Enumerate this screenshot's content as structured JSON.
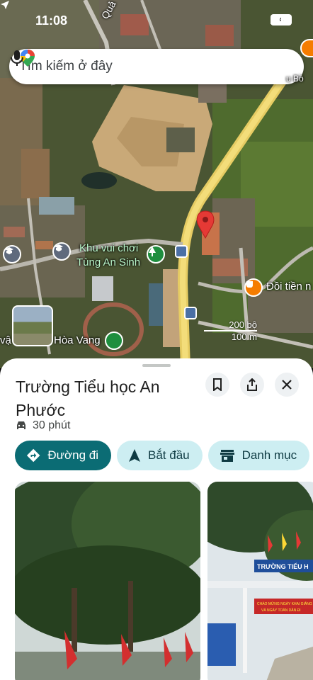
{
  "status_bar": {
    "time": "11:08",
    "battery": "4"
  },
  "search": {
    "placeholder": "Tìm kiếm ở đây"
  },
  "map": {
    "labels": {
      "park_line1": "Khu vui chơi",
      "park_line2": "Tùng An Sinh",
      "cafe": "Đồi tiền n",
      "hoa_vang": "Hòa Vang",
      "vat_prefix": "vậ",
      "road_top": "Quả",
      "top_right": "u Bồ"
    },
    "scale": {
      "feet": "200 bộ",
      "meters": "100 m"
    }
  },
  "place": {
    "title": "Trường Tiểu học An Phước",
    "travel_time": "30 phút",
    "buttons": {
      "directions": "Đường đi",
      "start": "Bắt đầu",
      "category": "Danh mục"
    },
    "photo2_sign": "TRƯỜNG TIỂU H",
    "photo2_banner1": "CHÀO MỪNG NGÀY KHAI GIẢNG",
    "photo2_banner2": "VÀ NGÀY TOÀN DÂN ĐI"
  },
  "icons": {
    "location_arrow": "location-arrow-icon",
    "maps_pin": "maps-pin-icon",
    "mic": "mic-icon",
    "bookmark": "bookmark-icon",
    "share": "share-icon",
    "close": "close-icon",
    "car": "car-icon",
    "directions": "directions-icon",
    "navigation": "navigation-arrow-icon",
    "store": "store-icon"
  },
  "colors": {
    "primary_chip": "#0b6c74",
    "secondary_chip": "#cdeef2",
    "pin_red": "#e53935"
  }
}
